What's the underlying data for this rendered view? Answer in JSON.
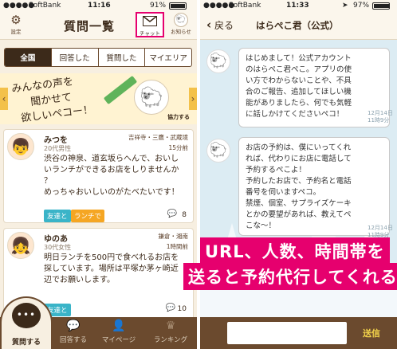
{
  "left": {
    "status": {
      "carrier": "SoftBank",
      "time": "11:16",
      "battery": "91%"
    },
    "nav": {
      "settings_label": "設定",
      "title": "質問一覧",
      "chat_label": "チャット",
      "notice_label": "お知らせ"
    },
    "segments": [
      "全国",
      "回答した",
      "質問した",
      "マイエリア"
    ],
    "banner": {
      "line1": "みんなの声を",
      "line2": "聞かせて",
      "line3": "欲しいペコー！",
      "tag": "協力する",
      "arrow_left": "‹",
      "arrow_right": "›"
    },
    "posts": [
      {
        "name": "みつを",
        "profile": "20代男性",
        "location": "吉祥寺・三鷹・武蔵境",
        "time": "15分前",
        "text": [
          "渋谷の神泉、道玄坂らへんで、おいし",
          "いランチができるお店をしりませんか",
          "？",
          "めっちゃおいしいのがたべたいです！"
        ],
        "tags": [
          "友達と",
          "ランチで"
        ],
        "count": "8"
      },
      {
        "name": "ゆのあ",
        "profile": "30代女性",
        "location": "鎌倉・湘南",
        "time": "1時間前",
        "text": [
          "明日ランチを500円で食べれるお店を",
          "探しています。場所は平塚か茅ヶ崎近",
          "辺でお願いします。"
        ],
        "tags": [
          "友達と"
        ],
        "count": "10"
      }
    ],
    "tabs": [
      "質問する",
      "回答する",
      "マイページ",
      "ランキング"
    ]
  },
  "right": {
    "status": {
      "carrier": "SoftBank",
      "time": "11:33",
      "battery": "97%"
    },
    "nav": {
      "back": "戻る",
      "title": "はらぺこ君（公式）"
    },
    "messages": [
      {
        "lines": [
          "はじめまして！公式アカウント",
          "のはらぺこ君ぺこ。アプリの使",
          "い方でわからないことや、不具",
          "合のご報告、追加してほしい機",
          "能がありましたら、何でも気軽",
          "に話しかけてくださいペコ！"
        ],
        "date": "12月14日",
        "time": "11時9分"
      },
      {
        "lines": [
          "お店の予約は、僕にいってくれ",
          "れば、代わりにお店に電話して",
          "予約するぺこよ！",
          "予約したお店で、予約名と電話",
          "番号を伺いますペコ。",
          "禁煙、個室、サプライズケーキ",
          "とかの要望があれば、教えてペ",
          "こな～！"
        ],
        "date": "12月14日",
        "time": "11時9分"
      }
    ],
    "overlay": [
      "URL、人数、時間帯を",
      "送ると予約代行してくれる"
    ],
    "send_label": "送信"
  },
  "colors": {
    "brown": "#6b4a2e",
    "highlight": "#e6006e",
    "orange": "#f5a623",
    "teal": "#3ab4c8"
  }
}
